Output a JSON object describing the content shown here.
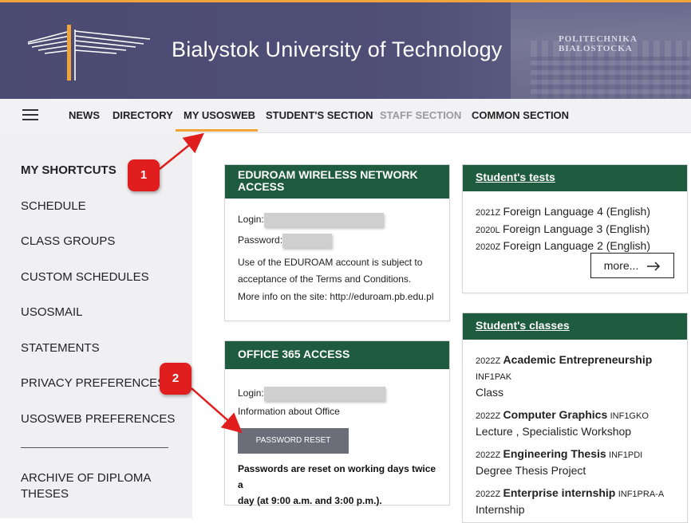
{
  "header": {
    "title": "Bialystok University of Technology",
    "building_sign": "POLITECHNIKA BIAŁOSTOCKA",
    "accent_color": "#f2a43c",
    "banner_color": "#4b4a71"
  },
  "nav": {
    "menu_icon": "hamburger-menu-icon",
    "items": [
      {
        "label": "NEWS"
      },
      {
        "label": "DIRECTORY"
      },
      {
        "label": "MY USOSWEB",
        "active": true
      },
      {
        "label": "STUDENT'S SECTION"
      },
      {
        "label": "STAFF SECTION",
        "disabled": true
      },
      {
        "label": "COMMON SECTION"
      }
    ]
  },
  "sidebar": {
    "items": [
      {
        "label": "MY SHORTCUTS",
        "selected": true
      },
      {
        "label": "SCHEDULE"
      },
      {
        "label": "CLASS GROUPS"
      },
      {
        "label": "CUSTOM SCHEDULES"
      },
      {
        "label": "USOSMAIL"
      },
      {
        "label": "STATEMENTS"
      },
      {
        "label": "PRIVACY PREFERENCES"
      },
      {
        "label": "USOSWEB PREFERENCES"
      }
    ],
    "archive_line1": "ARCHIVE OF DIPLOMA",
    "archive_line2": "THESES"
  },
  "eduroam": {
    "title": "EDUROAM WIRELESS NETWORK ACCESS",
    "login_label": "Login:",
    "password_label": "Password:",
    "terms_line1": "Use of the EDUROAM account is subject to",
    "terms_line2": "acceptance of the Terms and Conditions.",
    "more_info": "More info on the site: http://eduroam.pb.edu.pl"
  },
  "office": {
    "title": "OFFICE 365 ACCESS",
    "login_label": "Login:",
    "info": "Information about Office",
    "reset_button": "PASSWORD RESET",
    "note_line1": "Passwords are reset on working days twice a",
    "note_line2": "day (at 9:00 a.m. and 3:00 p.m.)."
  },
  "tests": {
    "title": "Student's tests",
    "items": [
      {
        "term": "2021Z",
        "name": "Foreign Language 4 (English)"
      },
      {
        "term": "2020L",
        "name": "Foreign Language 3 (English)"
      },
      {
        "term": "2020Z",
        "name": "Foreign Language 2 (English)"
      }
    ],
    "more_label": "more...",
    "more_icon": "arrow-right-icon"
  },
  "classes": {
    "title": "Student's classes",
    "items": [
      {
        "term": "2022Z",
        "name": "Academic Entrepreneurship",
        "code": "INF1PAK",
        "type": "Class"
      },
      {
        "term": "2022Z",
        "name": "Computer Graphics",
        "code": "INF1GKO",
        "type": "Lecture ,  Specialistic Workshop"
      },
      {
        "term": "2022Z",
        "name": "Engineering Thesis",
        "code": "INF1PDI",
        "type": "Degree Thesis Project"
      },
      {
        "term": "2022Z",
        "name": "Enterprise internship",
        "code": "INF1PRA-A",
        "type": "Internship"
      }
    ]
  },
  "annotations": {
    "badge1": "1",
    "badge2": "2",
    "color": "#e01e1e"
  }
}
